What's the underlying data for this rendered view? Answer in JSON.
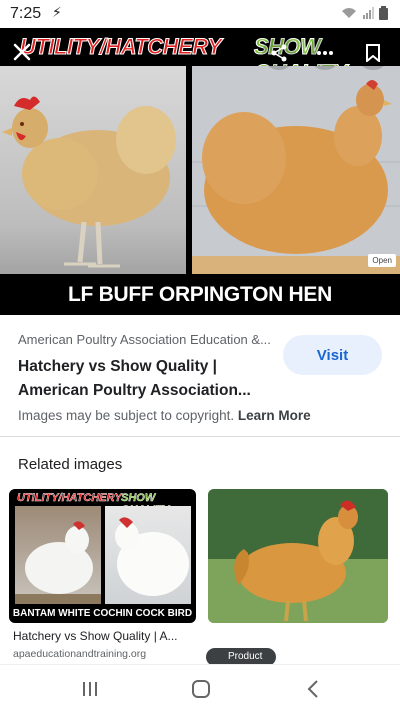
{
  "status": {
    "time": "7:25",
    "bolt": "⚡"
  },
  "viewer": {
    "banner_left": "UTILITY/HATCHERY",
    "banner_right": "SHOW QUALITY",
    "caption": "LF BUFF ORPINGTON HEN",
    "open_badge": "Open"
  },
  "result": {
    "source": "American Poultry Association Education &...",
    "title_line1": "Hatchery vs Show Quality |",
    "title_line2": "American Poultry Association...",
    "visit_label": "Visit",
    "copyright_text": "Images may be subject to copyright.",
    "learn_more": "Learn More"
  },
  "related": {
    "heading": "Related images",
    "items": [
      {
        "banner_left": "UTILITY/HATCHERY",
        "banner_right": "SHOW QUALITY",
        "caption": "BANTAM WHITE COCHIN COCK BIRD",
        "title": "Hatchery vs Show Quality | A...",
        "site": "apaeducationandtraining.org"
      },
      {
        "badge": "Product"
      }
    ]
  },
  "colors": {
    "accent": "#1967d2",
    "visit_bg": "#e8f0fe",
    "banner_red": "#e02020",
    "banner_green": "#7fc241"
  }
}
